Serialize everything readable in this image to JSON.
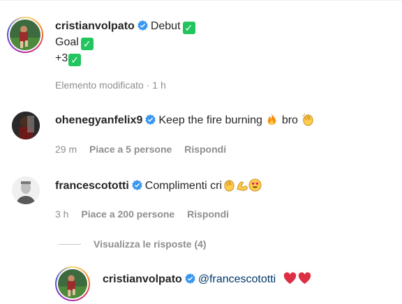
{
  "comments": [
    {
      "username": "cristianvolpato",
      "lines": [
        "Debut",
        "Goal",
        "+3"
      ],
      "timestamp": "Elemento modificato · 1 h"
    },
    {
      "username": "ohenegyanfelix9",
      "text_before": "Keep the fire burning",
      "text_after": "bro",
      "time": "29 m",
      "likes": "Piace a 5 persone",
      "reply": "Rispondi"
    },
    {
      "username": "francescototti",
      "text": "Complimenti cri",
      "time": "3 h",
      "likes": "Piace a 200 persone",
      "reply": "Rispondi",
      "view_replies": "Visualizza le risposte (4)"
    },
    {
      "username": "cristianvolpato",
      "mention": "@francescototti"
    }
  ],
  "icons": [
    "verified-badge-icon",
    "checkmark-emoji",
    "fire-emoji",
    "clapping-hands-emoji",
    "flexed-biceps-emoji",
    "heart-eyes-emoji",
    "red-heart-emoji"
  ],
  "colors": {
    "verified": "#3897f0",
    "text": "#262626",
    "meta": "#8e8e8e",
    "mention": "#00376b",
    "check": "#22c55e",
    "heart": "#e0245e"
  }
}
